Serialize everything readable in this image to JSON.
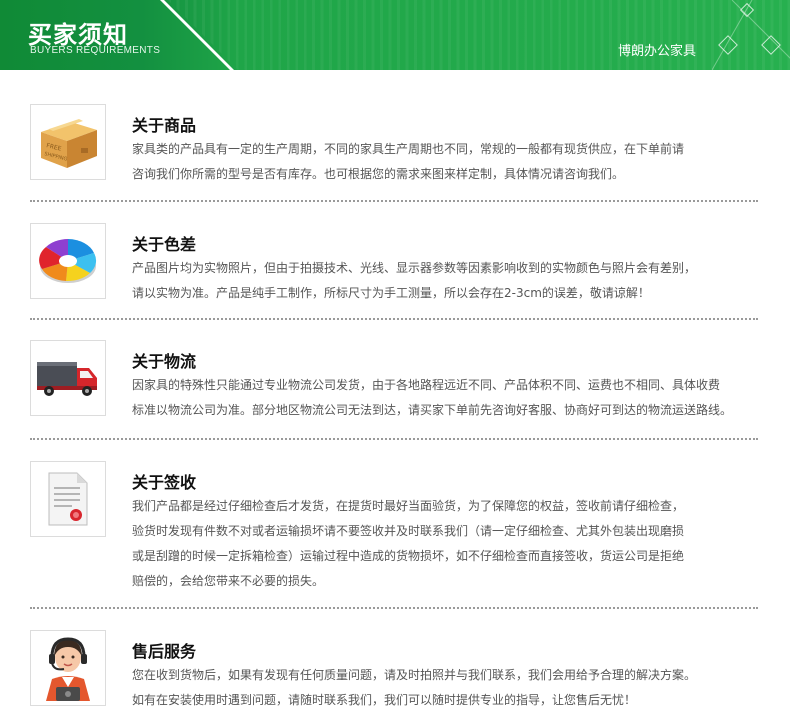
{
  "header": {
    "title": "买家须知",
    "subtitle": "BUYERS REQUIREMENTS",
    "brand": "博朗办公家具"
  },
  "colors": {
    "header_green": "#1fa548",
    "header_dark_green": "#108a36"
  },
  "sections": [
    {
      "title": "关于商品",
      "icon": "shipping-box-icon",
      "lines": [
        "家具类的产品具有一定的生产周期，不同的家具生产周期也不同，常规的一般都有现货供应，在下单前请",
        "咨询我们你所需的型号是否有库存。也可根据您的需求来图来样定制，具体情况请咨询我们。"
      ]
    },
    {
      "title": "关于色差",
      "icon": "color-wheel-icon",
      "lines": [
        "产品图片均为实物照片，但由于拍摄技术、光线、显示器参数等因素影响收到的实物颜色与照片会有差别，",
        "请以实物为准。产品是纯手工制作，所标尺寸为手工测量，所以会存在2-3cm的误差，敬请谅解！"
      ]
    },
    {
      "title": "关于物流",
      "icon": "delivery-truck-icon",
      "lines": [
        "因家具的特殊性只能通过专业物流公司发货，由于各地路程远近不同、产品体积不同、运费也不相同、具体收费",
        "标准以物流公司为准。部分地区物流公司无法到达，请买家下单前先咨询好客服、协商好可到达的物流运送路线。"
      ]
    },
    {
      "title": "关于签收",
      "icon": "document-seal-icon",
      "lines": [
        "我们产品都是经过仔细检查后才发货，在提货时最好当面验货，为了保障您的权益，签收前请仔细检查，",
        "验货时发现有件数不对或者运输损坏请不要签收并及时联系我们（请一定仔细检查、尤其外包装出现磨损",
        "或是刮蹭的时候一定拆箱检查）运输过程中造成的货物损坏，如不仔细检查而直接签收，货运公司是拒绝",
        "赔偿的，会给您带来不必要的损失。"
      ]
    },
    {
      "title": "售后服务",
      "icon": "customer-service-icon",
      "lines": [
        "您在收到货物后，如果有发现有任何质量问题，请及时拍照并与我们联系，我们会用给予合理的解决方案。",
        "如有在安装使用时遇到问题，请随时联系我们，我们可以随时提供专业的指导，让您售后无忧！"
      ]
    }
  ]
}
